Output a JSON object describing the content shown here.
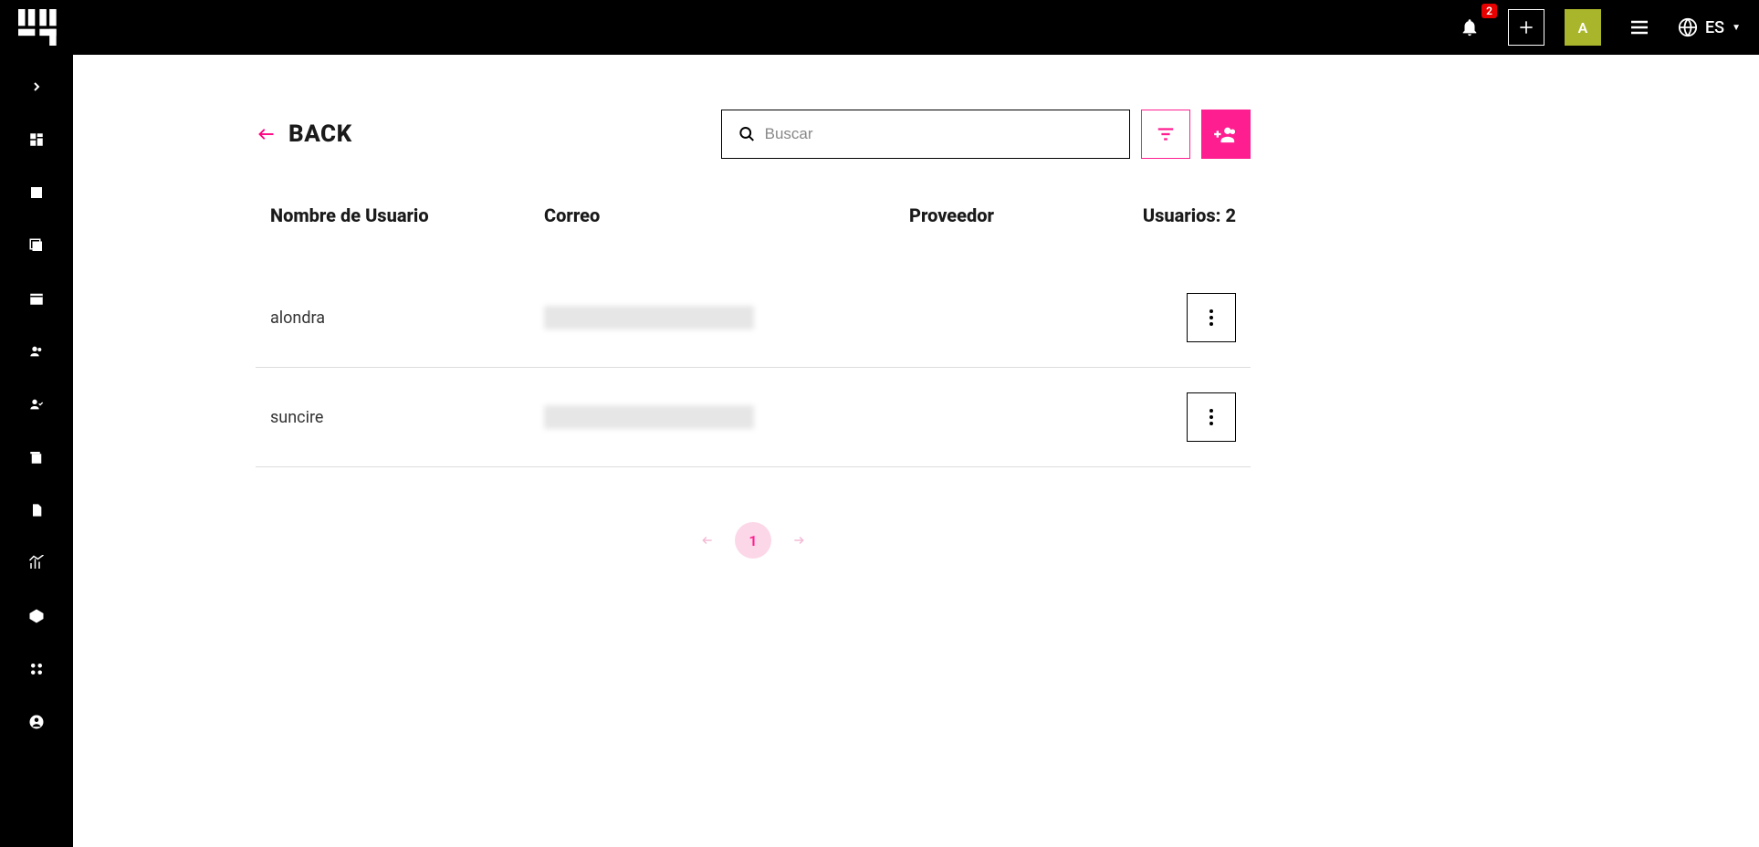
{
  "header": {
    "notif_count": "2",
    "avatar_initial": "A",
    "language": "ES"
  },
  "page": {
    "back_label": "BACK",
    "search_placeholder": "Buscar"
  },
  "columns": {
    "username": "Nombre de Usuario",
    "email": "Correo",
    "provider": "Proveedor",
    "count_label": "Usuarios: 2"
  },
  "rows": [
    {
      "username": "alondra",
      "provider": ""
    },
    {
      "username": "suncire",
      "provider": ""
    }
  ],
  "pagination": {
    "current": "1"
  }
}
